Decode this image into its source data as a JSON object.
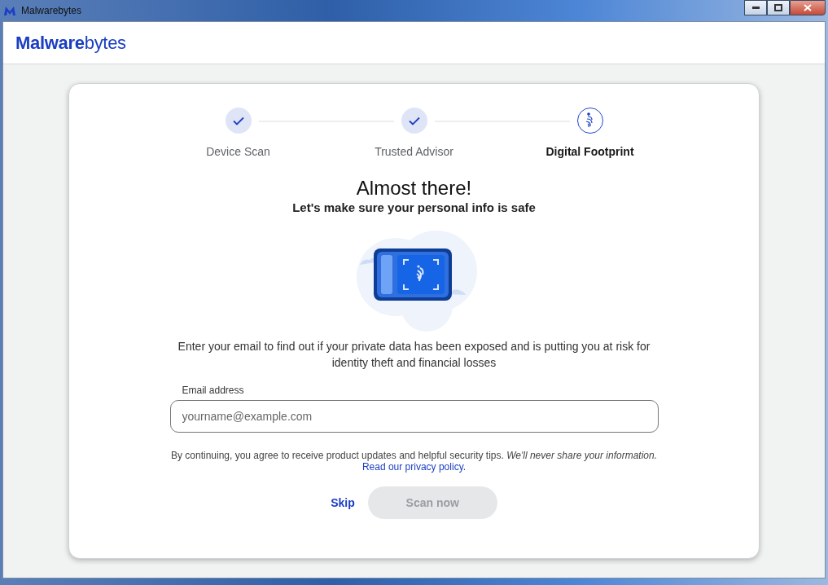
{
  "window": {
    "title": "Malwarebytes"
  },
  "header": {
    "logo": "**Malware**bytes"
  },
  "steps": [
    {
      "label": "Device Scan",
      "done": true,
      "selected": false
    },
    {
      "label": "Trusted Advisor",
      "done": true,
      "selected": false
    },
    {
      "label": "Digital Footprint",
      "done": false,
      "selected": true
    }
  ],
  "heading": "Almost there!",
  "subheading": "Let's make sure your personal info is safe",
  "description": "Enter your email to find out if your private data has been exposed and is putting you at risk for identity theft and financial losses",
  "email_field": {
    "label": "Email address",
    "placeholder": "yourname@example.com"
  },
  "consent": {
    "text": "By continuing, you agree to receive product updates and helpful security tips. *We'll never share your information.*",
    "link": "Read our privacy policy",
    "after_link": "."
  },
  "buttons": [
    {
      "label": "Skip",
      "kind": "link",
      "disabled": false
    },
    {
      "label": "Scan now",
      "kind": "primary",
      "disabled": true
    }
  ]
}
